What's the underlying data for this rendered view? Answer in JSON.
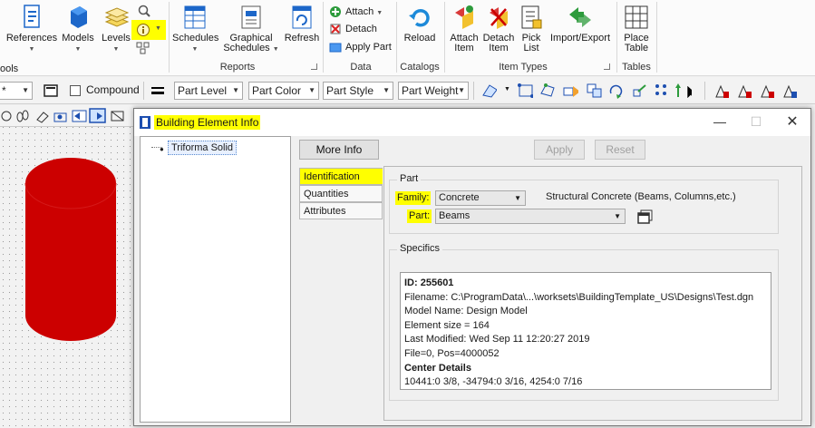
{
  "ribbon": {
    "left_partial": "ools",
    "references": "References",
    "models": "Models",
    "levels": "Levels",
    "schedules": "Schedules",
    "graphical_schedules_line1": "Graphical",
    "graphical_schedules_line2": "Schedules",
    "refresh": "Refresh",
    "attach": "Attach",
    "detach": "Detach",
    "apply_part": "Apply Part",
    "reload": "Reload",
    "attach_item_line1": "Attach",
    "attach_item_line2": "Item",
    "detach_item_line1": "Detach",
    "detach_item_line2": "Item",
    "pick_list_line1": "Pick",
    "pick_list_line2": "List",
    "import_export": "Import/Export",
    "place_table_line1": "Place",
    "place_table_line2": "Table",
    "groups": {
      "reports": "Reports",
      "data": "Data",
      "catalogs": "Catalogs",
      "item_types": "Item Types",
      "tables": "Tables"
    }
  },
  "toolbar": {
    "left_combo": "*",
    "compound": "Compound",
    "part_level": "Part Level",
    "part_color": "Part Color",
    "part_style": "Part Style",
    "part_weight": "Part Weight"
  },
  "dialog": {
    "title": "Building Element Info",
    "tree_item": "Triforma Solid",
    "more_info": "More Info",
    "apply": "Apply",
    "reset": "Reset",
    "tabs": [
      "Identification",
      "Quantities",
      "Attributes"
    ],
    "part_group": "Part",
    "family_label": "Family:",
    "family_value": "Concrete",
    "family_description": "Structural Concrete (Beams, Columns,etc.)",
    "part_label": "Part:",
    "part_value": "Beams",
    "specifics_group": "Specifics",
    "specifics": {
      "id": "ID: 255601",
      "filename": "Filename: C:\\ProgramData\\...\\worksets\\BuildingTemplate_US\\Designs\\Test.dgn",
      "model_name": "Model Name: Design Model",
      "element_size": "Element size = 164",
      "last_modified": "Last Modified: Wed Sep 11 12:20:27 2019",
      "file_pos": "File=0, Pos=4000052",
      "center_details": "Center Details",
      "center_value": "10441:0 3/8, -34794:0 3/16, 4254:0 7/16"
    }
  },
  "colors": {
    "highlight": "#ffff00",
    "solid_red": "#cc0000",
    "accent_blue": "#1e6fd9"
  }
}
